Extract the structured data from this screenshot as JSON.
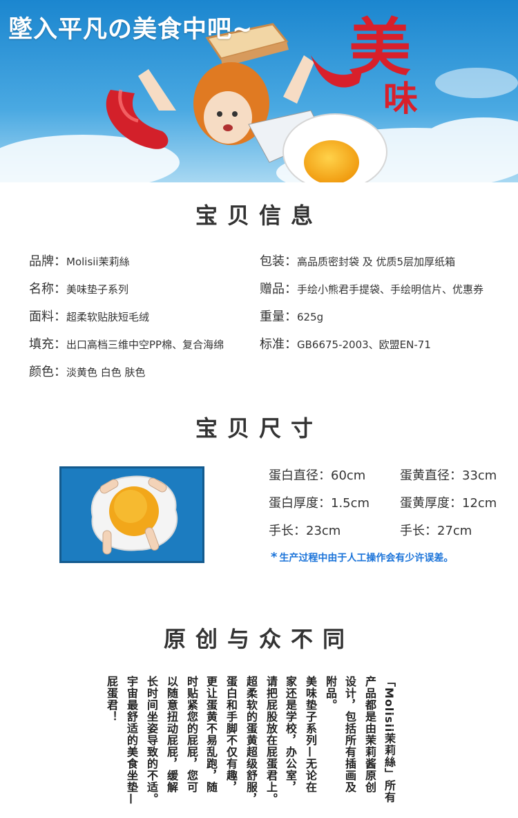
{
  "banner": {
    "title": "墜入平凡の美食中吧~",
    "logo_glyph": "美",
    "logo_glyph2": "味"
  },
  "sections": {
    "info_heading": "宝贝信息",
    "size_heading": "宝贝尺寸",
    "original_heading": "原创与众不同"
  },
  "info": {
    "left": [
      {
        "key": "品牌：",
        "value": "Molisii茉莉絲"
      },
      {
        "key": "名称：",
        "value": "美味垫子系列"
      },
      {
        "key": "面料：",
        "value": "超柔软贴肤短毛绒"
      },
      {
        "key": "填充：",
        "value": "出口高档三维中空PP棉、复合海绵"
      },
      {
        "key": "颜色：",
        "value": "淡黄色 白色 肤色"
      }
    ],
    "right": [
      {
        "key": "包装：",
        "value": "高品质密封袋 及 优质5层加厚纸箱"
      },
      {
        "key": "赠品：",
        "value": "手绘小熊君手提袋、手绘明信片、优惠券"
      },
      {
        "key": "重量：",
        "value": "625g"
      },
      {
        "key": "标准：",
        "value": "GB6675-2003、欧盟EN-71"
      }
    ]
  },
  "size": {
    "items": [
      "蛋白直径：60cm",
      "蛋黄直径：33cm",
      "蛋白厚度：1.5cm",
      "蛋黄厚度：12cm",
      "手长：23cm",
      "手长：27cm"
    ],
    "note_star": "*",
    "note": "生产过程中由于人工操作会有少许误差。"
  },
  "original": {
    "columns": [
      "「Molisii茉莉絲」所有",
      "产品都是由茉莉酱原创",
      "设计，包括所有插画及",
      "附品。",
      "美味垫子系列—无论在",
      "家还是学校，办公室，",
      "请把屁股放在屁蛋君上。",
      "超柔软的蛋黄超级舒服，",
      "蛋白和手脚不仅有趣，",
      "更让蛋黄不易乱跑，随",
      "时贴紧您的屁屁，您可",
      "以随意扭动屁屁，缓解",
      "长时间坐姿导致的不适。",
      "宇宙最舒适的美食坐垫—",
      "屁蛋君！"
    ]
  },
  "colors": {
    "sky_top": "#1f8fd6",
    "sky_bottom": "#9fd3f1",
    "logo_red": "#d8202b",
    "yolk": "#f4b41a",
    "note_blue": "#1a73d9"
  }
}
